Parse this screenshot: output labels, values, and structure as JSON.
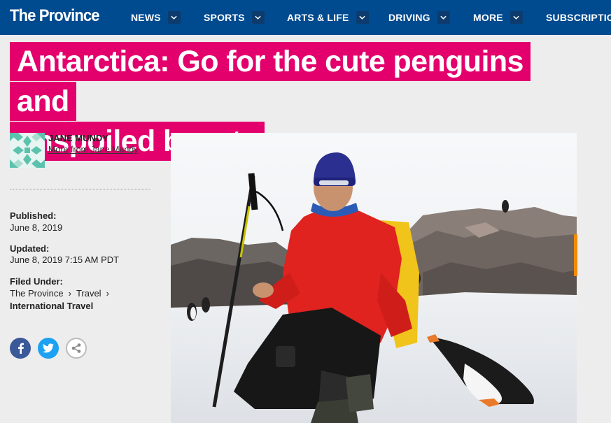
{
  "nav": {
    "logo": "The Province",
    "items": [
      {
        "label": "NEWS"
      },
      {
        "label": "SPORTS"
      },
      {
        "label": "ARTS & LIFE"
      },
      {
        "label": "DRIVING"
      },
      {
        "label": "MORE"
      },
      {
        "label": "SUBSCRIPTION"
      }
    ]
  },
  "article": {
    "headline_line1": "Antarctica: Go for the cute penguins and",
    "headline_line2": "unspoiled beauty"
  },
  "byline": {
    "author": "JANE MUNDY",
    "more_link": "More from Jane Mundy"
  },
  "meta": {
    "published_label": "Published:",
    "published_value": "June 8, 2019",
    "updated_label": "Updated:",
    "updated_value": "June 8, 2019 7:15 AM PDT",
    "filed_label": "Filed Under:",
    "crumbs": [
      "The Province",
      "Travel"
    ],
    "crumb_separator": "›",
    "category": "International Travel"
  },
  "social": {
    "icons": [
      "facebook-icon",
      "twitter-icon",
      "share-icon"
    ]
  },
  "colors": {
    "nav_bg": "#004a8f",
    "headline_bg": "#e3006d",
    "page_bg": "#ededed"
  }
}
